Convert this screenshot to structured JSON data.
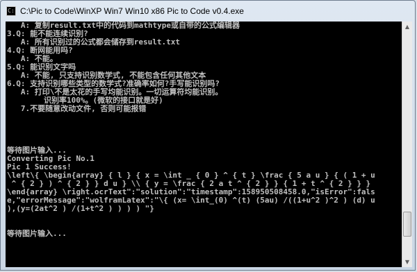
{
  "window": {
    "title": "C:\\Pic to Code\\WinXP Win7 Win10 x86 Pic to Code v0.4.exe",
    "icon": "console-app-icon"
  },
  "console": {
    "lines": [
      "   A: 复制result.txt中的代码到mathtype或自带的公式编辑器",
      "3.Q: 能不能连续识别?",
      "   A: 所有识别过的公式都会储存到result.txt",
      "4.Q: 断网能用吗?",
      "   A: 不能。",
      "5.Q: 能识别文字吗",
      "   A: 不能, 只支持识别数学式, 不能包含任何其他文本",
      "6.Q: 支持识别哪些类型的数学式?准确率如何?手写能识别吗?",
      "   A: 打印\\不是太花的手写均能识别。一切运算符均能识别。",
      "        识别率100%。(微软的接口就是好)",
      "   7.不要随意改动文件, 否则可能报错",
      "",
      "",
      "",
      "",
      "等待图片输入...",
      "Converting Pic No.1",
      "Pic 1 Success!",
      "\\left\\{ \\begin{array} { l } { x = \\int _ { 0 } ^ { t } \\frac { 5 a u } { ( 1 + u",
      " ^ { 2 } ) ^ { 2 } } d u } \\\\ { y = \\frac { 2 a t ^ { 2 } } { 1 + t ^ { 2 } } }",
      "\\end{array} \\right.ocrText\":\"solution\":\"timestamp\":158950508458.0,\"isError\":fals",
      "e,\"errorMessage\":\"wolframLatex\":\"\\{ (x= \\int_(0) ^(t) (5au) /((1+u^2 )^2 ) (d) u",
      "),(y=(2at^2 ) /(1+t^2 ) ) ) ) \"}",
      "",
      "",
      "等待图片输入..."
    ]
  },
  "scrollbar": {
    "up_arrow": "▲",
    "down_arrow": "▼",
    "position": 0.9
  }
}
